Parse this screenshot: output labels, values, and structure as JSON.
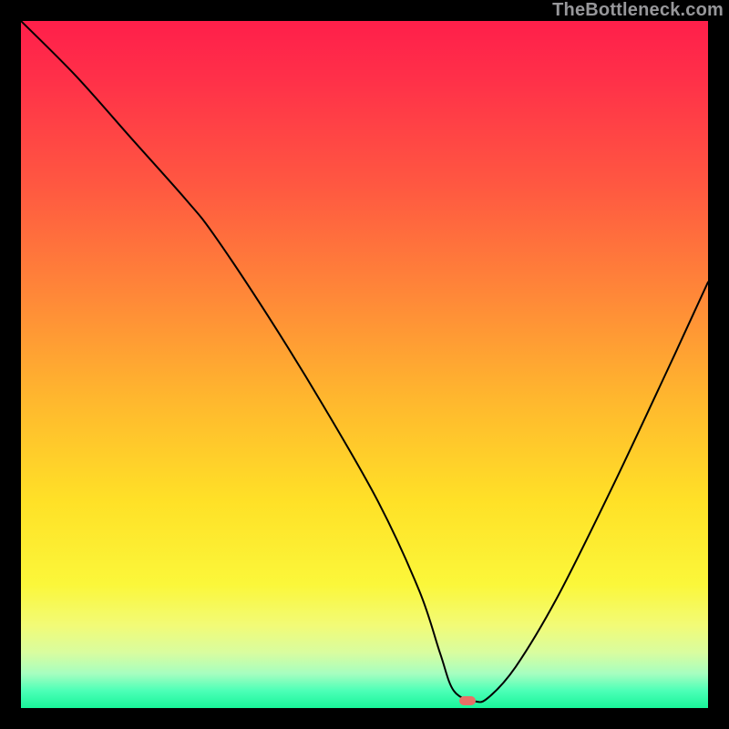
{
  "watermark": "TheBottleneck.com",
  "marker": {
    "x_pct": 65,
    "y_pct": 99
  },
  "chart_data": {
    "type": "line",
    "title": "",
    "xlabel": "",
    "ylabel": "",
    "xlim": [
      0,
      100
    ],
    "ylim": [
      0,
      100
    ],
    "annotations": [],
    "series": [
      {
        "name": "bottleneck-curve",
        "x": [
          0,
          8,
          16,
          24,
          28,
          36,
          44,
          52,
          58,
          61,
          63,
          66,
          68,
          72,
          78,
          86,
          94,
          100
        ],
        "y": [
          100,
          92,
          83,
          74,
          69,
          57,
          44,
          30,
          17,
          8,
          2.5,
          1,
          1.5,
          6,
          16,
          32,
          49,
          62
        ]
      }
    ],
    "marker": {
      "x": 65,
      "y": 1
    }
  }
}
